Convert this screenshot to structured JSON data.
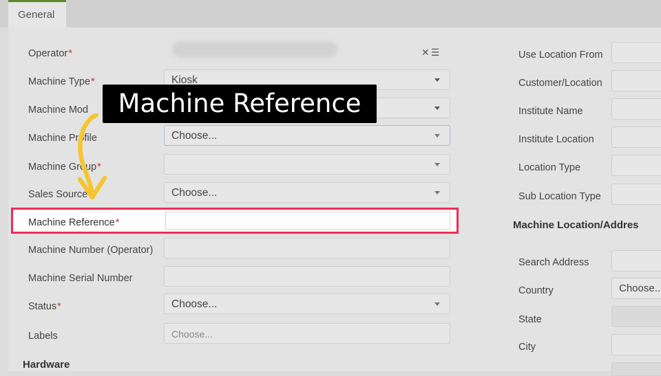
{
  "tabs": [
    {
      "label": "General"
    }
  ],
  "callout": {
    "text": "Machine Reference"
  },
  "left_form": {
    "operator": {
      "label": "Operator",
      "required": "*"
    },
    "machine_type": {
      "label": "Machine Type",
      "required": "*",
      "value": "Kiosk"
    },
    "machine_model": {
      "label": "Machine Mod"
    },
    "machine_profile": {
      "label": "Machine Profile",
      "value": "Choose..."
    },
    "machine_group": {
      "label": "Machine Group",
      "required": "*"
    },
    "sales_source": {
      "label": "Sales Source",
      "value": "Choose..."
    },
    "machine_reference": {
      "label": "Machine Reference",
      "required": "*"
    },
    "machine_number": {
      "label": "Machine Number (Operator)"
    },
    "machine_serial": {
      "label": "Machine Serial Number"
    },
    "status": {
      "label": "Status",
      "required": "*",
      "value": "Choose..."
    },
    "labels": {
      "label": "Labels",
      "placeholder": "Choose..."
    },
    "hardware_heading": "Hardware"
  },
  "right_form": {
    "use_location_from": "Use Location From",
    "customer_location": "Customer/Location",
    "institute_name": "Institute Name",
    "institute_location": "Institute Location",
    "location_type": "Location Type",
    "sub_location_type": "Sub Location Type",
    "section_heading": "Machine Location/Addres",
    "search_address": "Search Address",
    "country": {
      "label": "Country",
      "value": "Choose.."
    },
    "state": "State",
    "city": "City"
  }
}
